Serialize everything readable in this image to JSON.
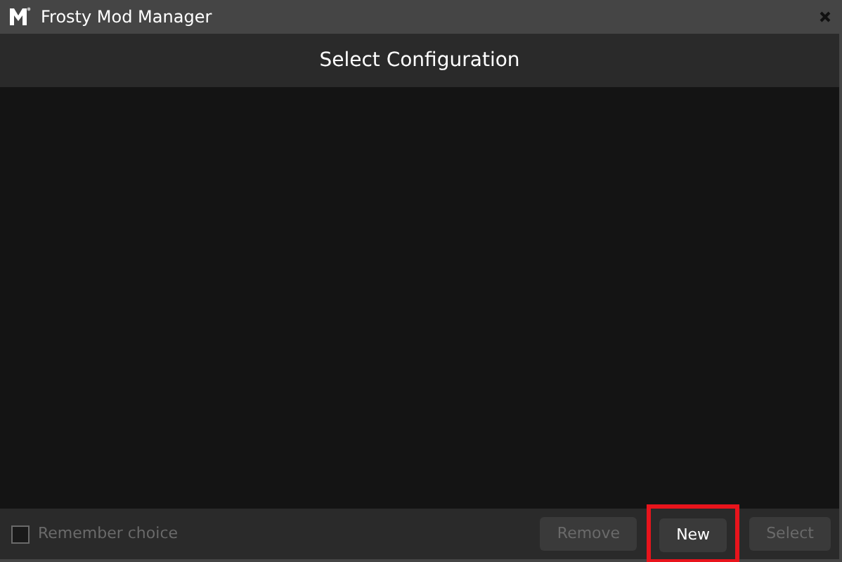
{
  "window": {
    "title": "Frosty Mod Manager"
  },
  "header": {
    "title": "Select Configuration"
  },
  "footer": {
    "remember": {
      "label": "Remember choice",
      "checked": false,
      "disabled": true
    },
    "buttons": [
      {
        "label": "Remove",
        "disabled": true,
        "highlighted": false
      },
      {
        "label": "New",
        "disabled": false,
        "highlighted": true
      },
      {
        "label": "Select",
        "disabled": true,
        "highlighted": false
      }
    ]
  }
}
